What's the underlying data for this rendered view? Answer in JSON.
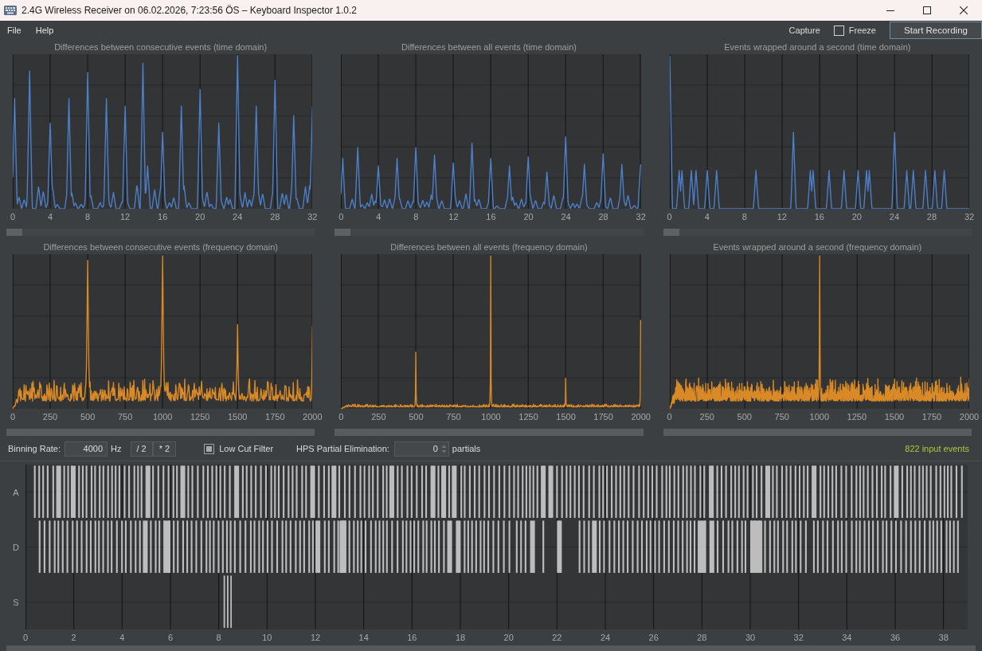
{
  "window": {
    "title": "2.4G Wireless Receiver on 06.02.2026, 7:23:56 ÖS – Keyboard Inspector 1.0.2"
  },
  "menu": [
    "File",
    "Help"
  ],
  "toolbar": {
    "capture_label": "Capture",
    "freeze": {
      "label": "Freeze",
      "checked": false
    },
    "record_button": "Start Recording"
  },
  "charts": [
    {
      "kind": "time",
      "title": "Differences between consecutive events (time domain)",
      "x_labels": [
        "0",
        "4",
        "8",
        "12",
        "16",
        "20",
        "24",
        "28",
        "32"
      ]
    },
    {
      "kind": "time",
      "title": "Differences between all events (time domain)",
      "x_labels": [
        "0",
        "4",
        "8",
        "12",
        "16",
        "20",
        "24",
        "28",
        "32"
      ]
    },
    {
      "kind": "time",
      "title": "Events wrapped around a second (time domain)",
      "x_labels": [
        "0",
        "4",
        "8",
        "12",
        "16",
        "20",
        "24",
        "28",
        "32"
      ]
    },
    {
      "kind": "frequency",
      "title": "Differences between consecutive events (frequency domain)",
      "x_labels": [
        "0",
        "250",
        "500",
        "750",
        "1000",
        "1250",
        "1500",
        "1750",
        "2000"
      ]
    },
    {
      "kind": "frequency",
      "title": "Differences between all events (frequency domain)",
      "x_labels": [
        "0",
        "250",
        "500",
        "750",
        "1000",
        "1250",
        "1500",
        "1750",
        "2000"
      ]
    },
    {
      "kind": "frequency",
      "title": "Events wrapped around a second (frequency domain)",
      "x_labels": [
        "0",
        "250",
        "500",
        "750",
        "1000",
        "1250",
        "1500",
        "1750",
        "2000"
      ]
    }
  ],
  "controls": {
    "binning_rate_label": "Binning Rate:",
    "binning_rate_value": "4000",
    "binning_rate_unit": "Hz",
    "halve_button": "/ 2",
    "double_button": "* 2",
    "low_cut_filter": {
      "label": "Low Cut Filter",
      "checked": true
    },
    "hps_label": "HPS Partial Elimination:",
    "hps_value": "0",
    "hps_unit": "partials",
    "event_count": "822 input events"
  },
  "timeline": {
    "rows": [
      {
        "label": "A"
      },
      {
        "label": "D"
      },
      {
        "label": "S"
      }
    ],
    "x_labels": [
      "0",
      "2",
      "4",
      "6",
      "8",
      "10",
      "12",
      "14",
      "16",
      "18",
      "20",
      "22",
      "24",
      "26",
      "28",
      "30",
      "32",
      "34",
      "36",
      "38"
    ]
  }
}
